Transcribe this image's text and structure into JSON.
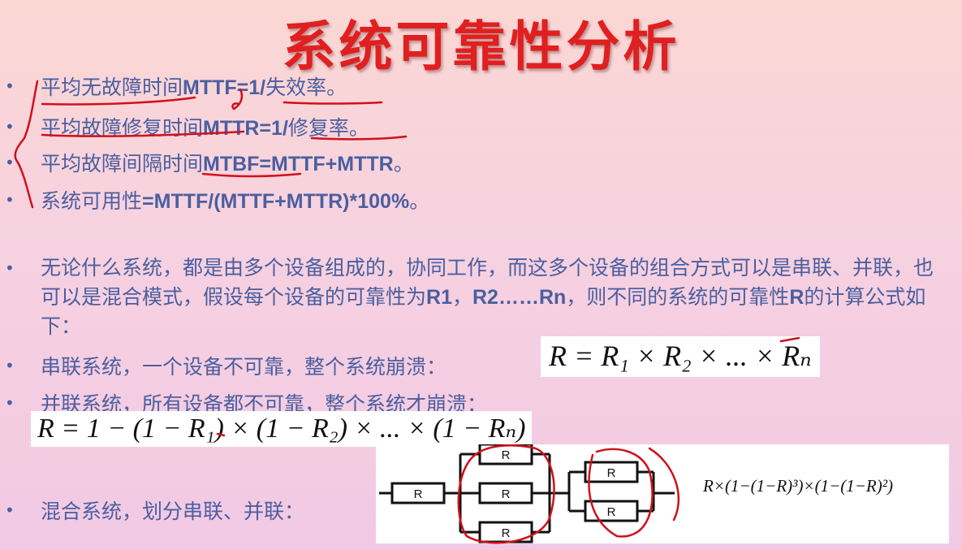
{
  "title": "系统可靠性分析",
  "bullet_char": "•",
  "items": [
    {
      "cn": "平均无故障时间",
      "formula": "MTTF=1/",
      "cn2": "失效率",
      "tail": "。"
    },
    {
      "cn": "平均故障修复时间",
      "formula": "MTTR=1/",
      "cn2": "修复率",
      "tail": "。"
    },
    {
      "cn": "平均故障间隔时间",
      "formula": "MTBF=MTTF+MTTR",
      "cn2": "",
      "tail": "。"
    },
    {
      "cn": "系统可用性",
      "formula": "=MTTF/(MTTF+MTTR)*100%",
      "cn2": "",
      "tail": "。"
    }
  ],
  "paragraph": {
    "p1": "无论什么系统，都是由多个设备组成的，协同工作，而这多个设备的组合方式可以是串联、并联，也可以是混合模式，假设每个设备的可靠性为",
    "r1": "R1",
    "comma": "，",
    "r2": "R2……Rn",
    "p2": "，则不同的系统的可靠性",
    "r": "R",
    "p3": "的计算公式如下："
  },
  "series": {
    "text": "串联系统，一个设备不可靠，整个系统崩溃：",
    "formula": "R = R₁ × R₂ × ... × Rₙ"
  },
  "parallel": {
    "text": "并联系统，所有设备都不可靠，整个系统才崩溃：",
    "formula": "R = 1 − (1 − R₁) × (1 − R₂) × ... × (1 − Rₙ)"
  },
  "mixed": {
    "text": "混合系统，划分串联、并联：",
    "formula": "R×(1−(1−R)³)×(1−(1−R)²)"
  },
  "diagram": {
    "resistor_label": "R"
  }
}
